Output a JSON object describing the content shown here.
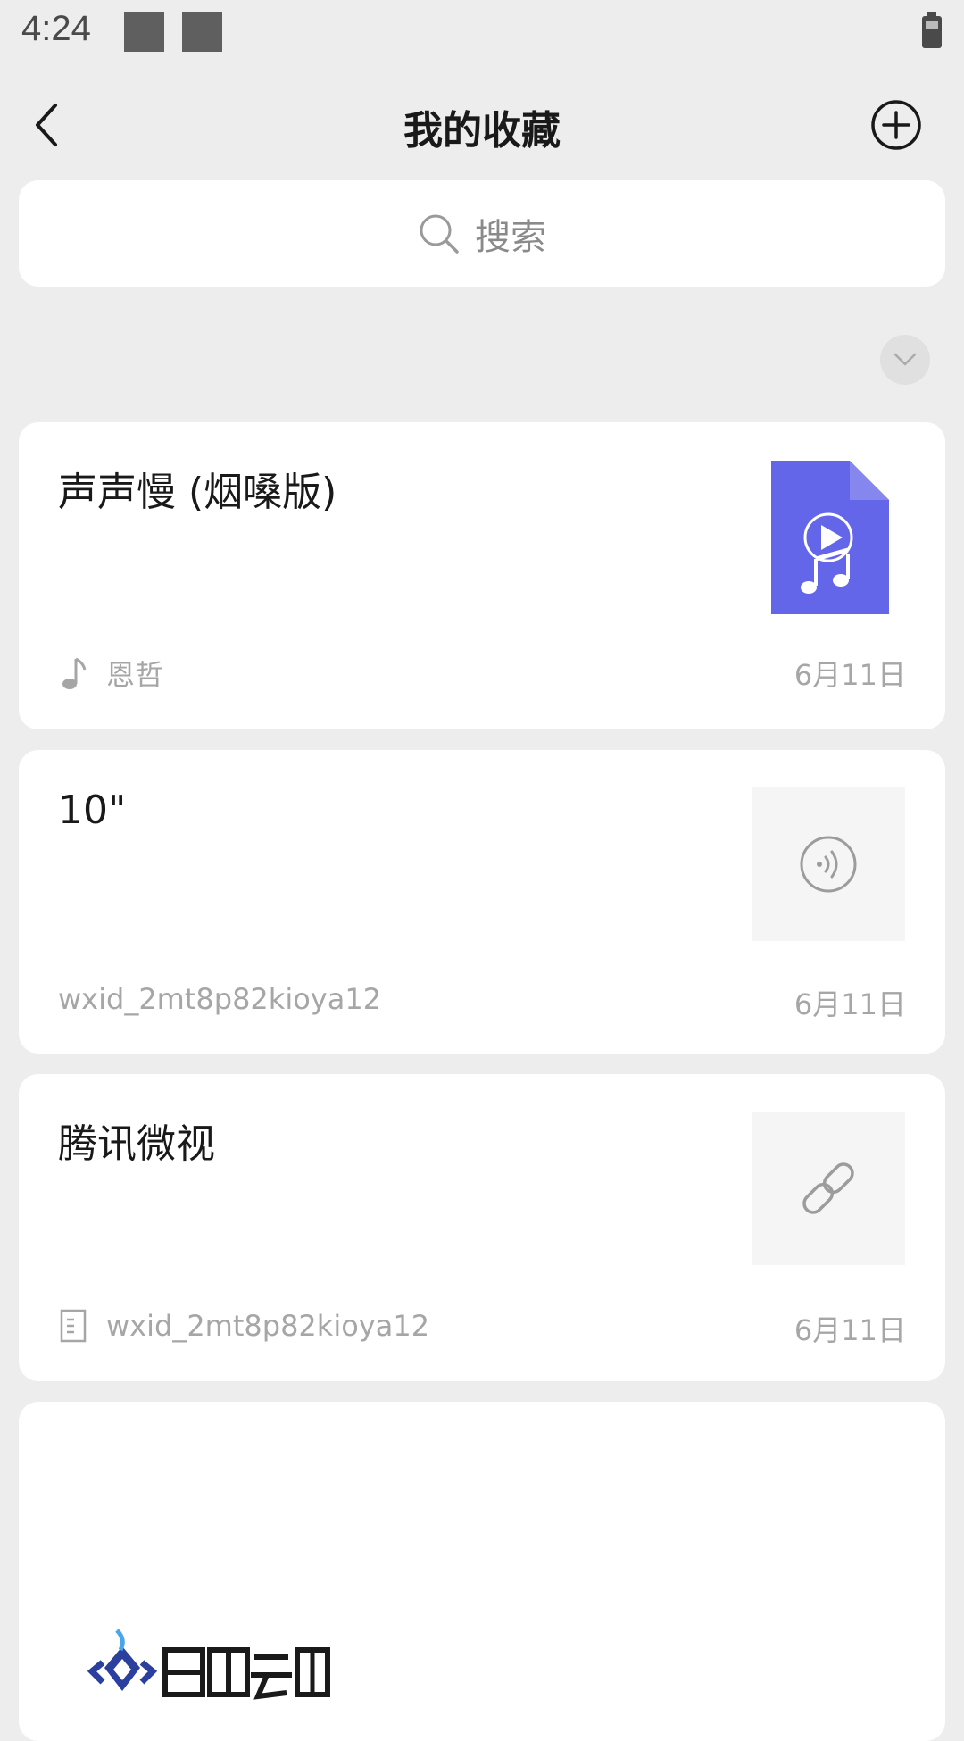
{
  "status_bar": {
    "time": "4:24"
  },
  "header": {
    "title": "我的收藏"
  },
  "search": {
    "placeholder": "搜索"
  },
  "colors": {
    "background": "#ededed",
    "card": "#ffffff",
    "music_accent": "#6366e8",
    "meta_text": "#a6a6a6"
  },
  "items": [
    {
      "title": "声声慢 (烟嗓版)",
      "meta": "恩哲",
      "meta_icon": "music-note-icon",
      "date": "6月11日",
      "thumbnail": "music-file-icon"
    },
    {
      "title": "10\"",
      "meta": "wxid_2mt8p82kioya12",
      "date": "6月11日",
      "thumbnail": "voice-icon"
    },
    {
      "title": "腾讯微视",
      "meta": "wxid_2mt8p82kioya12",
      "meta_icon": "document-icon",
      "date": "6月11日",
      "thumbnail": "link-icon"
    },
    {
      "thumbnail": "image-logo"
    }
  ]
}
